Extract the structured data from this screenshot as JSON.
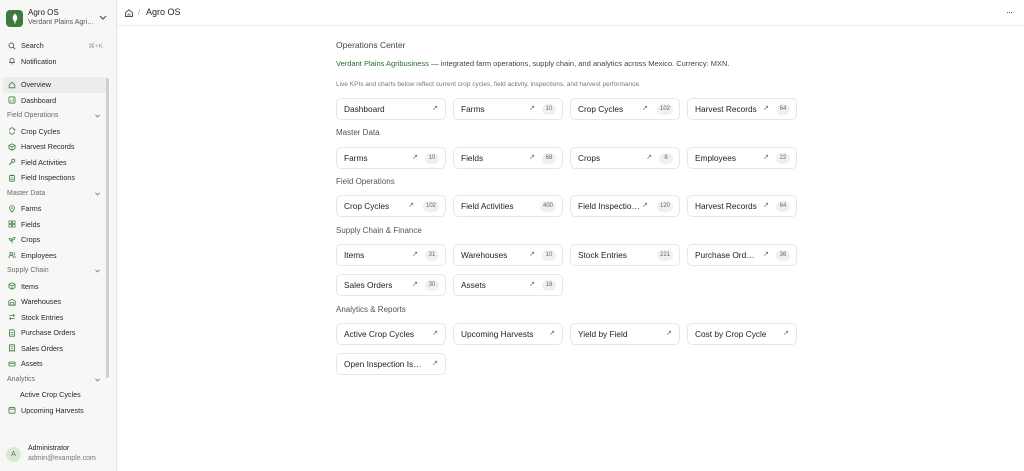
{
  "app": {
    "name": "Agro OS",
    "org": "Verdant Plains Agribusiness"
  },
  "sidebar": {
    "search": {
      "label": "Search",
      "shortcut": "⌘+K"
    },
    "notification": "Notification",
    "overview": "Overview",
    "dashboard": "Dashboard",
    "groups": {
      "field_operations": "Field Operations",
      "master_data": "Master Data",
      "supply_chain": "Supply Chain",
      "analytics": "Analytics"
    },
    "items": {
      "crop_cycles": "Crop Cycles",
      "harvest_records": "Harvest Records",
      "field_activities": "Field Activities",
      "field_inspections": "Field Inspections",
      "farms": "Farms",
      "fields": "Fields",
      "crops": "Crops",
      "employees": "Employees",
      "items": "Items",
      "warehouses": "Warehouses",
      "stock_entries": "Stock Entries",
      "purchase_orders": "Purchase Orders",
      "sales_orders": "Sales Orders",
      "assets": "Assets",
      "active_crop_cycles": "Active Crop Cycles",
      "upcoming_harvests": "Upcoming Harvests"
    }
  },
  "user": {
    "avatar": "A",
    "name": "Administrator",
    "email": "admin@example.com"
  },
  "topbar": {
    "separator": "/",
    "crumb": "Agro OS",
    "more": "···"
  },
  "main": {
    "title": "Operations Center",
    "intro_company": "Verdant Plains Agribusiness",
    "intro_text": " — integrated farm operations, supply chain, and analytics across Mexico. Currency: MXN.",
    "note": "Live KPIs and charts below reflect current crop cycles, field activity, inspections, and harvest performance.",
    "arrow": "↗",
    "top_cards": [
      {
        "label": "Dashboard",
        "count": ""
      },
      {
        "label": "Farms",
        "count": "10"
      },
      {
        "label": "Crop Cycles",
        "count": "102"
      },
      {
        "label": "Harvest Records",
        "count": "64"
      }
    ],
    "sections": {
      "master_data": {
        "title": "Master Data",
        "cards": [
          {
            "label": "Farms",
            "count": "10"
          },
          {
            "label": "Fields",
            "count": "68"
          },
          {
            "label": "Crops",
            "count": "8"
          },
          {
            "label": "Employees",
            "count": "22"
          }
        ]
      },
      "field_operations": {
        "title": "Field Operations",
        "cards": [
          {
            "label": "Crop Cycles",
            "count": "102"
          },
          {
            "label": "Field Activities",
            "count": "400"
          },
          {
            "label": "Field Inspections",
            "count": "120"
          },
          {
            "label": "Harvest Records",
            "count": "64"
          }
        ]
      },
      "supply_chain": {
        "title": "Supply Chain & Finance",
        "cards": [
          {
            "label": "Items",
            "count": "31"
          },
          {
            "label": "Warehouses",
            "count": "10"
          },
          {
            "label": "Stock Entries",
            "count": "221"
          },
          {
            "label": "Purchase Orders",
            "count": "36"
          },
          {
            "label": "Sales Orders",
            "count": "30"
          },
          {
            "label": "Assets",
            "count": "18"
          }
        ]
      },
      "analytics": {
        "title": "Analytics & Reports",
        "cards": [
          {
            "label": "Active Crop Cycles",
            "count": ""
          },
          {
            "label": "Upcoming Harvests",
            "count": ""
          },
          {
            "label": "Yield by Field",
            "count": ""
          },
          {
            "label": "Cost by Crop Cycle",
            "count": ""
          },
          {
            "label": "Open Inspection Issues",
            "count": ""
          }
        ]
      }
    }
  }
}
